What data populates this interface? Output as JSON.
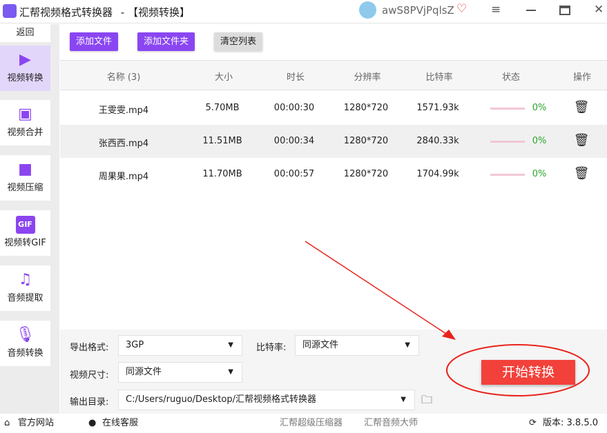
{
  "title": {
    "app": "汇帮视频格式转换器",
    "section": " - 【视频转换】",
    "username": "awS8PVjPqlsZ"
  },
  "sidebar": {
    "back": "返回",
    "items": [
      {
        "label": "视频转换",
        "icon": "video-convert-icon"
      },
      {
        "label": "视频合并",
        "icon": "video-merge-icon"
      },
      {
        "label": "视频压缩",
        "icon": "video-compress-icon"
      },
      {
        "label": "视频转GIF",
        "icon": "gif-icon"
      },
      {
        "label": "音频提取",
        "icon": "music-icon"
      },
      {
        "label": "音频转换",
        "icon": "microphone-icon"
      }
    ]
  },
  "toolbar": {
    "add_file": "添加文件",
    "add_folder": "添加文件夹",
    "clear": "清空列表"
  },
  "table": {
    "headers": [
      "名称 (3)",
      "大小",
      "时长",
      "分辨率",
      "比特率",
      "状态",
      "操作"
    ],
    "rows": [
      {
        "name": "王雯雯.mp4",
        "size": "5.70MB",
        "duration": "00:00:30",
        "resolution": "1280*720",
        "bitrate": "1571.93k",
        "progress": "0%"
      },
      {
        "name": "张西西.mp4",
        "size": "11.51MB",
        "duration": "00:00:34",
        "resolution": "1280*720",
        "bitrate": "2840.33k",
        "progress": "0%"
      },
      {
        "name": "周果果.mp4",
        "size": "11.70MB",
        "duration": "00:00:57",
        "resolution": "1280*720",
        "bitrate": "1704.99k",
        "progress": "0%"
      }
    ]
  },
  "settings": {
    "format_label": "导出格式:",
    "format": "3GP",
    "bitrate_label": "比特率:",
    "bitrate": "同源文件",
    "size_label": "视频尺寸:",
    "size": "同源文件",
    "output_label": "输出目录:",
    "output": "C:/Users/ruguo/Desktop/汇帮视频格式转换器",
    "start": "开始转换"
  },
  "footer": {
    "website": "官方网站",
    "service": "在线客服",
    "link1": "汇帮超级压缩器",
    "link2": "汇帮音频大师",
    "version": "版本: 3.8.5.0"
  },
  "colors": {
    "accent": "#8a46f2",
    "start": "#f2413a",
    "annotation": "#e8231c",
    "progress": "#2aa52a"
  }
}
